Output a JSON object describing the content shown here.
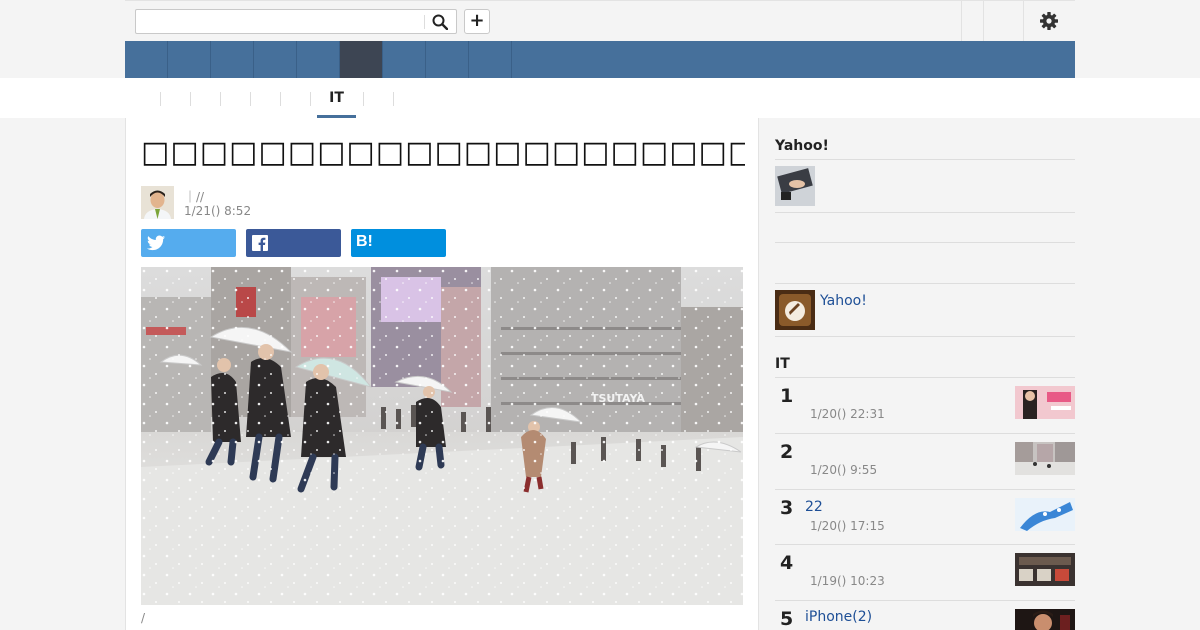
{
  "header": {
    "search": {
      "value": "",
      "placeholder": ""
    },
    "add_label": "+"
  },
  "subnav": {
    "active_label": "IT"
  },
  "article": {
    "headline": "□□□□□□□□□□□□□□□□□□□□□□□□□□□□□□□□□□□□□",
    "byline": "｜//",
    "date": "1/21() 8:52",
    "share_hatena_label": "B!",
    "caption": "/"
  },
  "sidebar": {
    "yahoo_heading": "Yahoo!",
    "yahoo_link": "Yahoo!",
    "ranking_heading": "IT",
    "ranking": [
      {
        "rank": "1",
        "title": "",
        "date": "1/20() 22:31"
      },
      {
        "rank": "2",
        "title": "",
        "date": "1/20() 9:55"
      },
      {
        "rank": "3",
        "title": "22",
        "date": "1/20() 17:15"
      },
      {
        "rank": "4",
        "title": "",
        "date": "1/19() 10:23"
      },
      {
        "rank": "5",
        "title": "iPhone(2)",
        "date": ""
      }
    ]
  },
  "colors": {
    "nav_blue": "#46709b",
    "nav_active": "#3d4553",
    "twitter": "#55acee",
    "facebook": "#3b5998",
    "hatena": "#008fde",
    "link": "#1e4f96"
  }
}
